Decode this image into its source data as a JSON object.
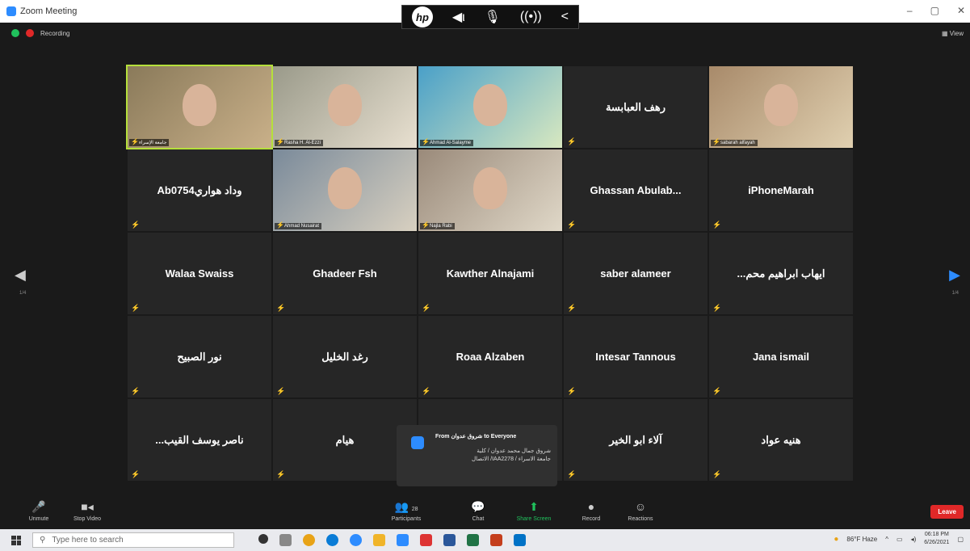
{
  "window": {
    "title": "Zoom Meeting",
    "minimize": "–",
    "restore": "▢",
    "close": "✕"
  },
  "hp_bar": {
    "logo": "hp",
    "speaker": "◀ι",
    "mic": "🎙",
    "broadcast": "((•))",
    "back": "<"
  },
  "status": {
    "recording": "Recording",
    "view": "View"
  },
  "tiles": [
    {
      "label": "جامعة الإسراء",
      "type": "video"
    },
    {
      "label": "Rasha H. Al-Ezzi",
      "type": "video"
    },
    {
      "label": "Ahmad Al-Salayme",
      "type": "video"
    },
    {
      "label": "رهف العبابسة",
      "type": "name"
    },
    {
      "label": "sabarah alfayah",
      "type": "video"
    },
    {
      "label": "Ab0754وداد هواري",
      "type": "name"
    },
    {
      "label": "Ahmad Nusairat",
      "type": "video"
    },
    {
      "label": "Najla Rabi",
      "type": "video"
    },
    {
      "label": "Ghassan Abulab...",
      "type": "name"
    },
    {
      "label": "iPhoneMarah",
      "type": "name"
    },
    {
      "label": "Walaa Swaiss",
      "type": "name"
    },
    {
      "label": "Ghadeer Fsh",
      "type": "name"
    },
    {
      "label": "Kawther Alnajami",
      "type": "name"
    },
    {
      "label": "saber alameer",
      "type": "name"
    },
    {
      "label": "...ايهاب ابراهيم محم",
      "type": "name"
    },
    {
      "label": "نور الصبيح",
      "type": "name"
    },
    {
      "label": "رغد الخليل",
      "type": "name"
    },
    {
      "label": "Roaa Alzaben",
      "type": "name"
    },
    {
      "label": "Intesar Tannous",
      "type": "name"
    },
    {
      "label": "Jana ismail",
      "type": "name"
    },
    {
      "label": "...ناصر يوسف القيب",
      "type": "name"
    },
    {
      "label": "هيام",
      "type": "name"
    },
    {
      "label": "",
      "type": "name"
    },
    {
      "label": "آلاء ابو الخير",
      "type": "name"
    },
    {
      "label": "هنيه عواد",
      "type": "name"
    }
  ],
  "nav": {
    "left_page": "1/4",
    "right_page": "1/4"
  },
  "chat_popup": {
    "from_label": "From",
    "sender": "شروق عدوان",
    "to_label": "to Everyone",
    "message_line1": "شروق جمال محمد عدوان / كلية",
    "message_line2": "جامعة الاسراء / IAA2278/ الاتصال"
  },
  "toolbar": {
    "unmute": "Unmute",
    "stop_video": "Stop Video",
    "participants": "Participants",
    "participants_count": "28",
    "chat": "Chat",
    "share_screen": "Share Screen",
    "record": "Record",
    "reactions": "Reactions",
    "leave": "Leave"
  },
  "taskbar": {
    "search_placeholder": "Type here to search",
    "weather": "86°F Haze",
    "time": "06:18 PM",
    "date": "6/26/2021"
  },
  "colors": {
    "accent": "#2d8cff",
    "leave": "#e02828",
    "active_speaker": "#b5e03b",
    "share": "#20c05c"
  }
}
